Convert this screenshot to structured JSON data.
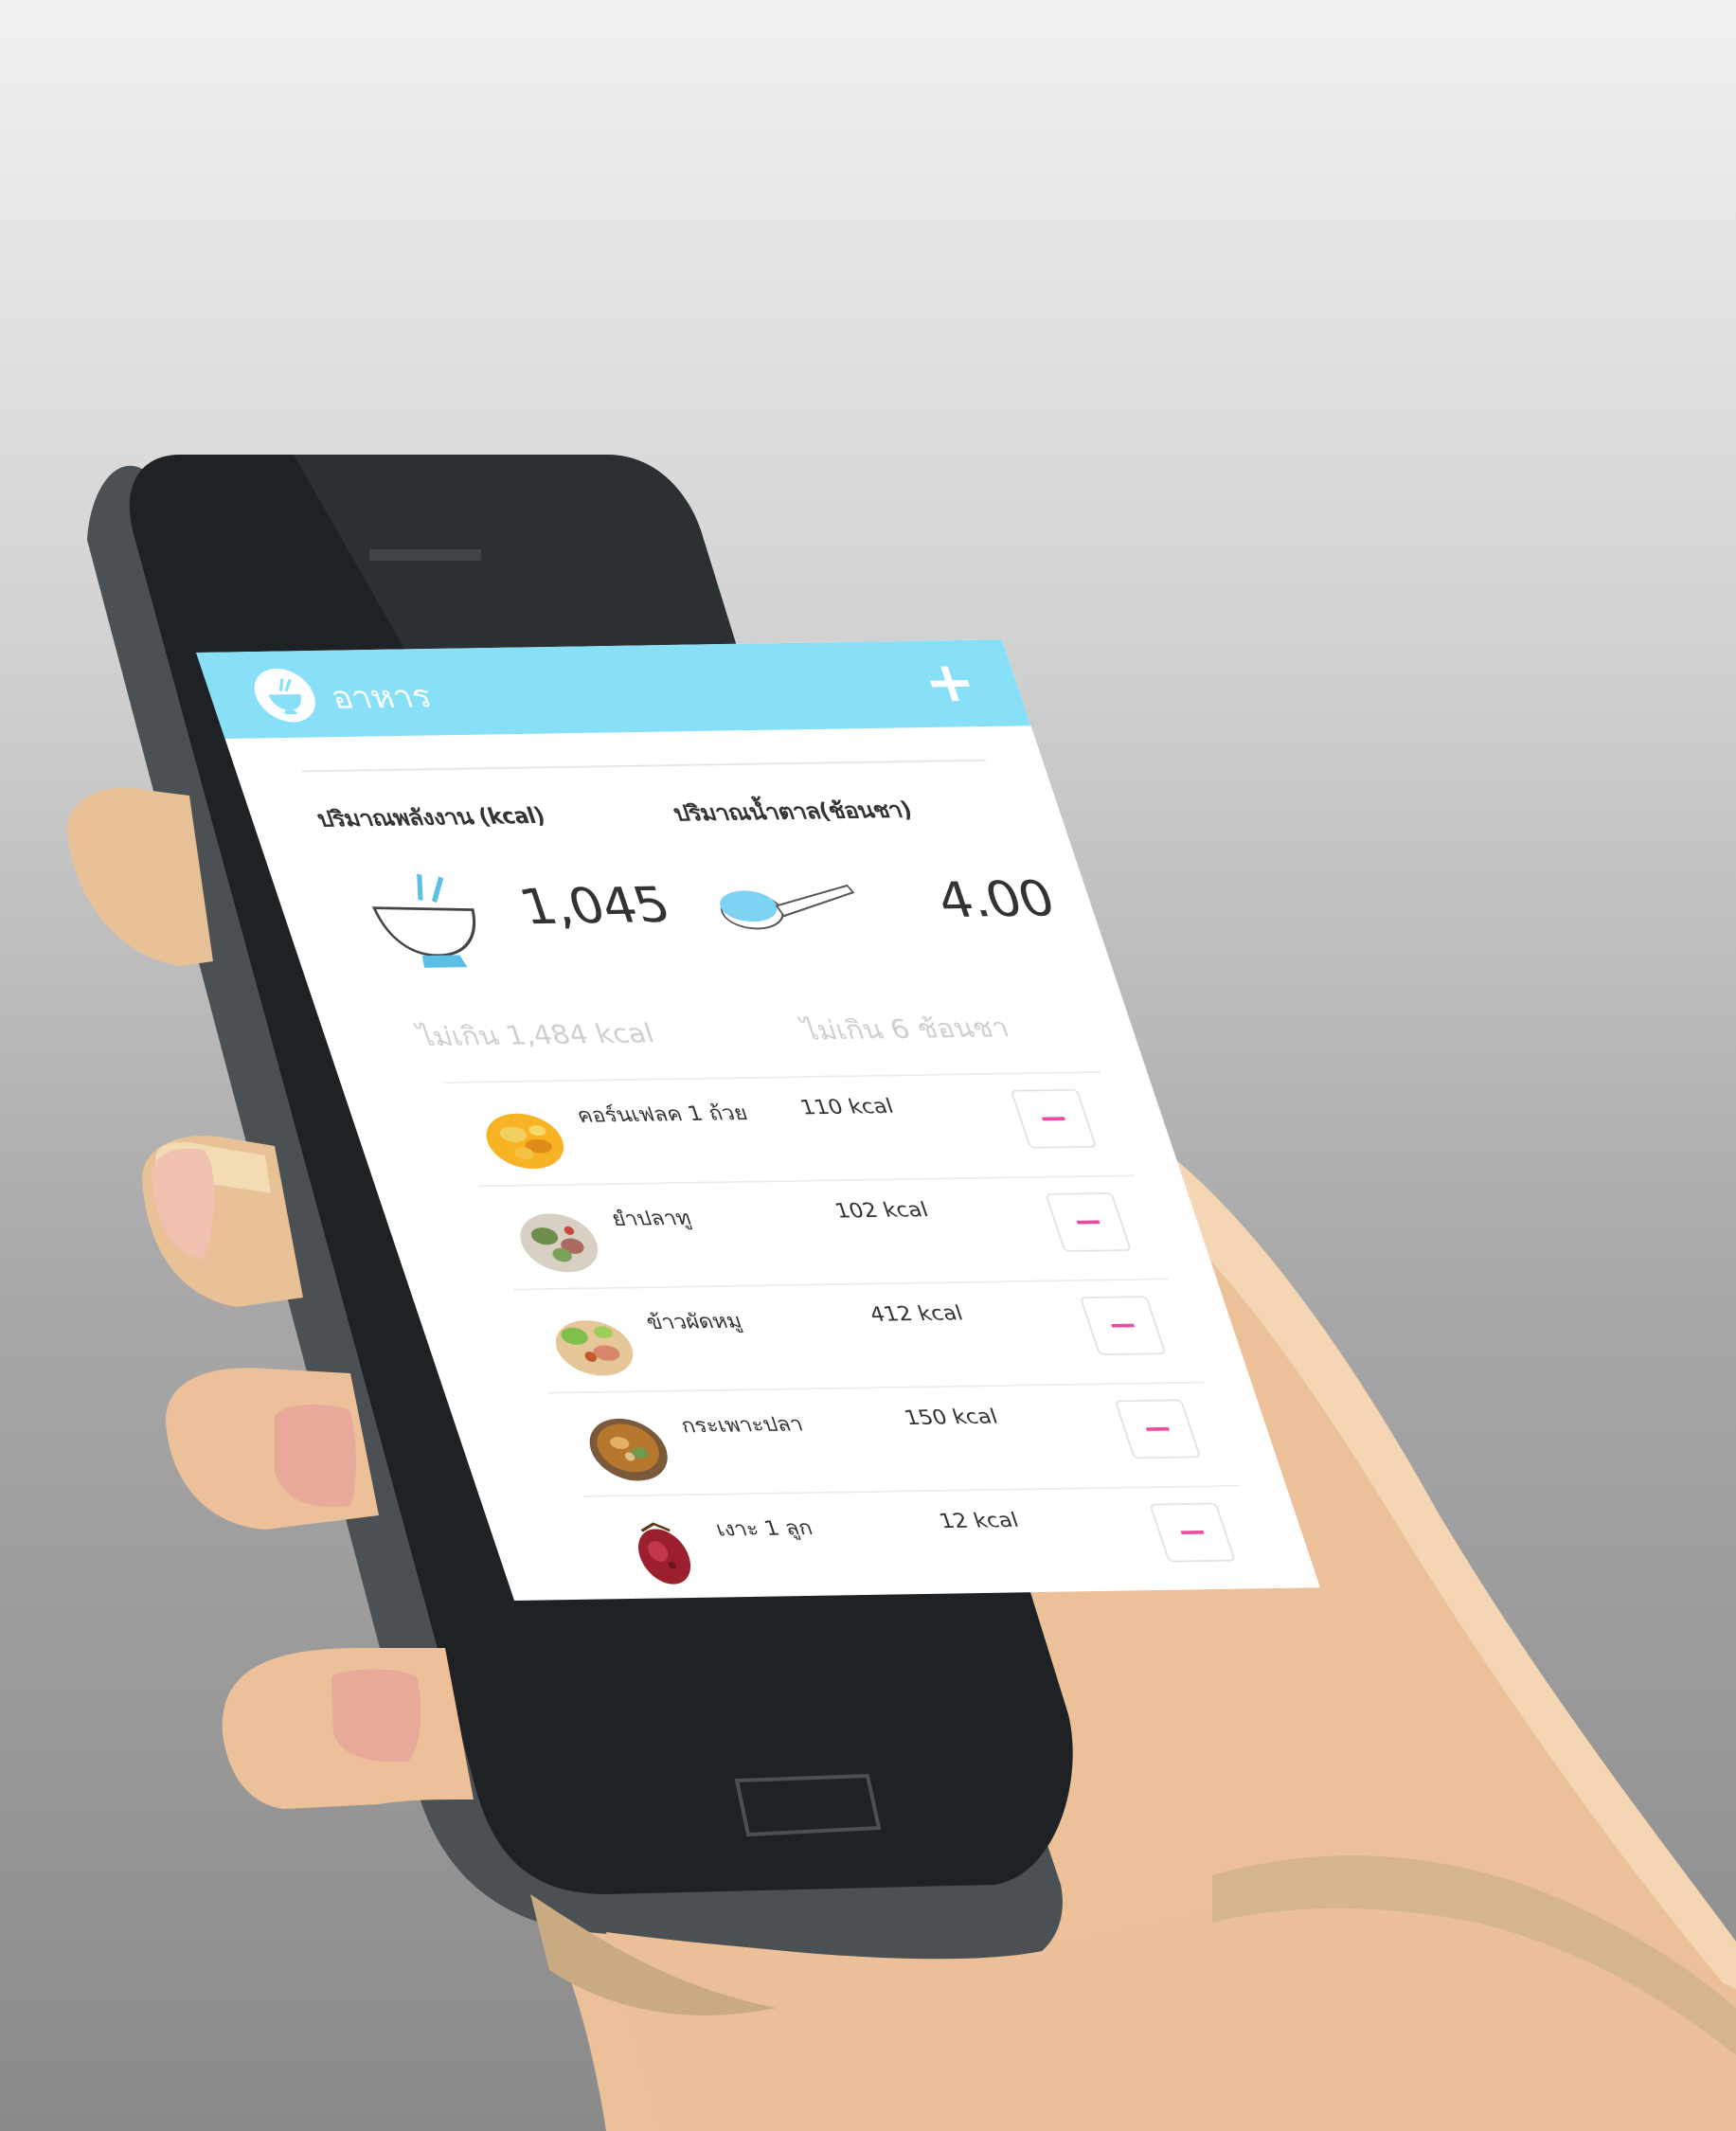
{
  "app": {
    "title": "อาหาร",
    "add_label": "+",
    "accent_color": "#87dff8"
  },
  "summary": {
    "energy_label": "ปริมาณพลังงาน (kcal)",
    "sugar_label": "ปริมาณน้ำตาล(ช้อนชา)",
    "energy_value": "1,045",
    "sugar_value": "4.00",
    "energy_limit": "ไม่เกิน 1,484 kcal",
    "sugar_limit": "ไม่เกิน 6 ช้อนชา"
  },
  "foods": [
    {
      "name": "คอร์นเฟลค 1 ถ้วย",
      "kcal": "110 kcal",
      "icon": "cornflakes-image"
    },
    {
      "name": "ยำปลาทู",
      "kcal": "102 kcal",
      "icon": "yam-pla-tu-image"
    },
    {
      "name": "ข้าวผัดหมู",
      "kcal": "412 kcal",
      "icon": "fried-rice-image"
    },
    {
      "name": "กระเพาะปลา",
      "kcal": "150 kcal",
      "icon": "fish-maw-soup-image"
    },
    {
      "name": "เงาะ 1 ลูก",
      "kcal": "12 kcal",
      "icon": "rambutan-image"
    }
  ],
  "colors": {
    "remove_accent": "#e94c9e",
    "limit_text": "#cfcfcf"
  }
}
